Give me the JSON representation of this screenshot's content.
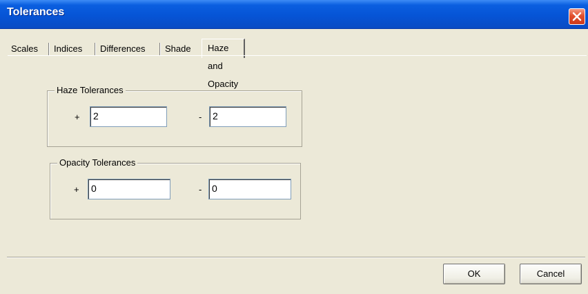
{
  "window": {
    "title": "Tolerances"
  },
  "tabs": [
    {
      "label": "Scales"
    },
    {
      "label": "Indices"
    },
    {
      "label": "Differences"
    },
    {
      "label": "Shade"
    },
    {
      "label": "Haze and Opacity",
      "active": true
    }
  ],
  "haze": {
    "label": "Haze Tolerances",
    "plus_sign": "+",
    "minus_sign": "-",
    "plus_value": "2",
    "minus_value": "2"
  },
  "opacity": {
    "label": "Opacity Tolerances",
    "plus_sign": "+",
    "minus_sign": "-",
    "plus_value": "0",
    "minus_value": "0"
  },
  "buttons": {
    "ok": "OK",
    "cancel": "Cancel"
  },
  "colors": {
    "titlebar": "#0654d6",
    "dialog_bg": "#ece9d8",
    "close_button": "#e2502d"
  }
}
